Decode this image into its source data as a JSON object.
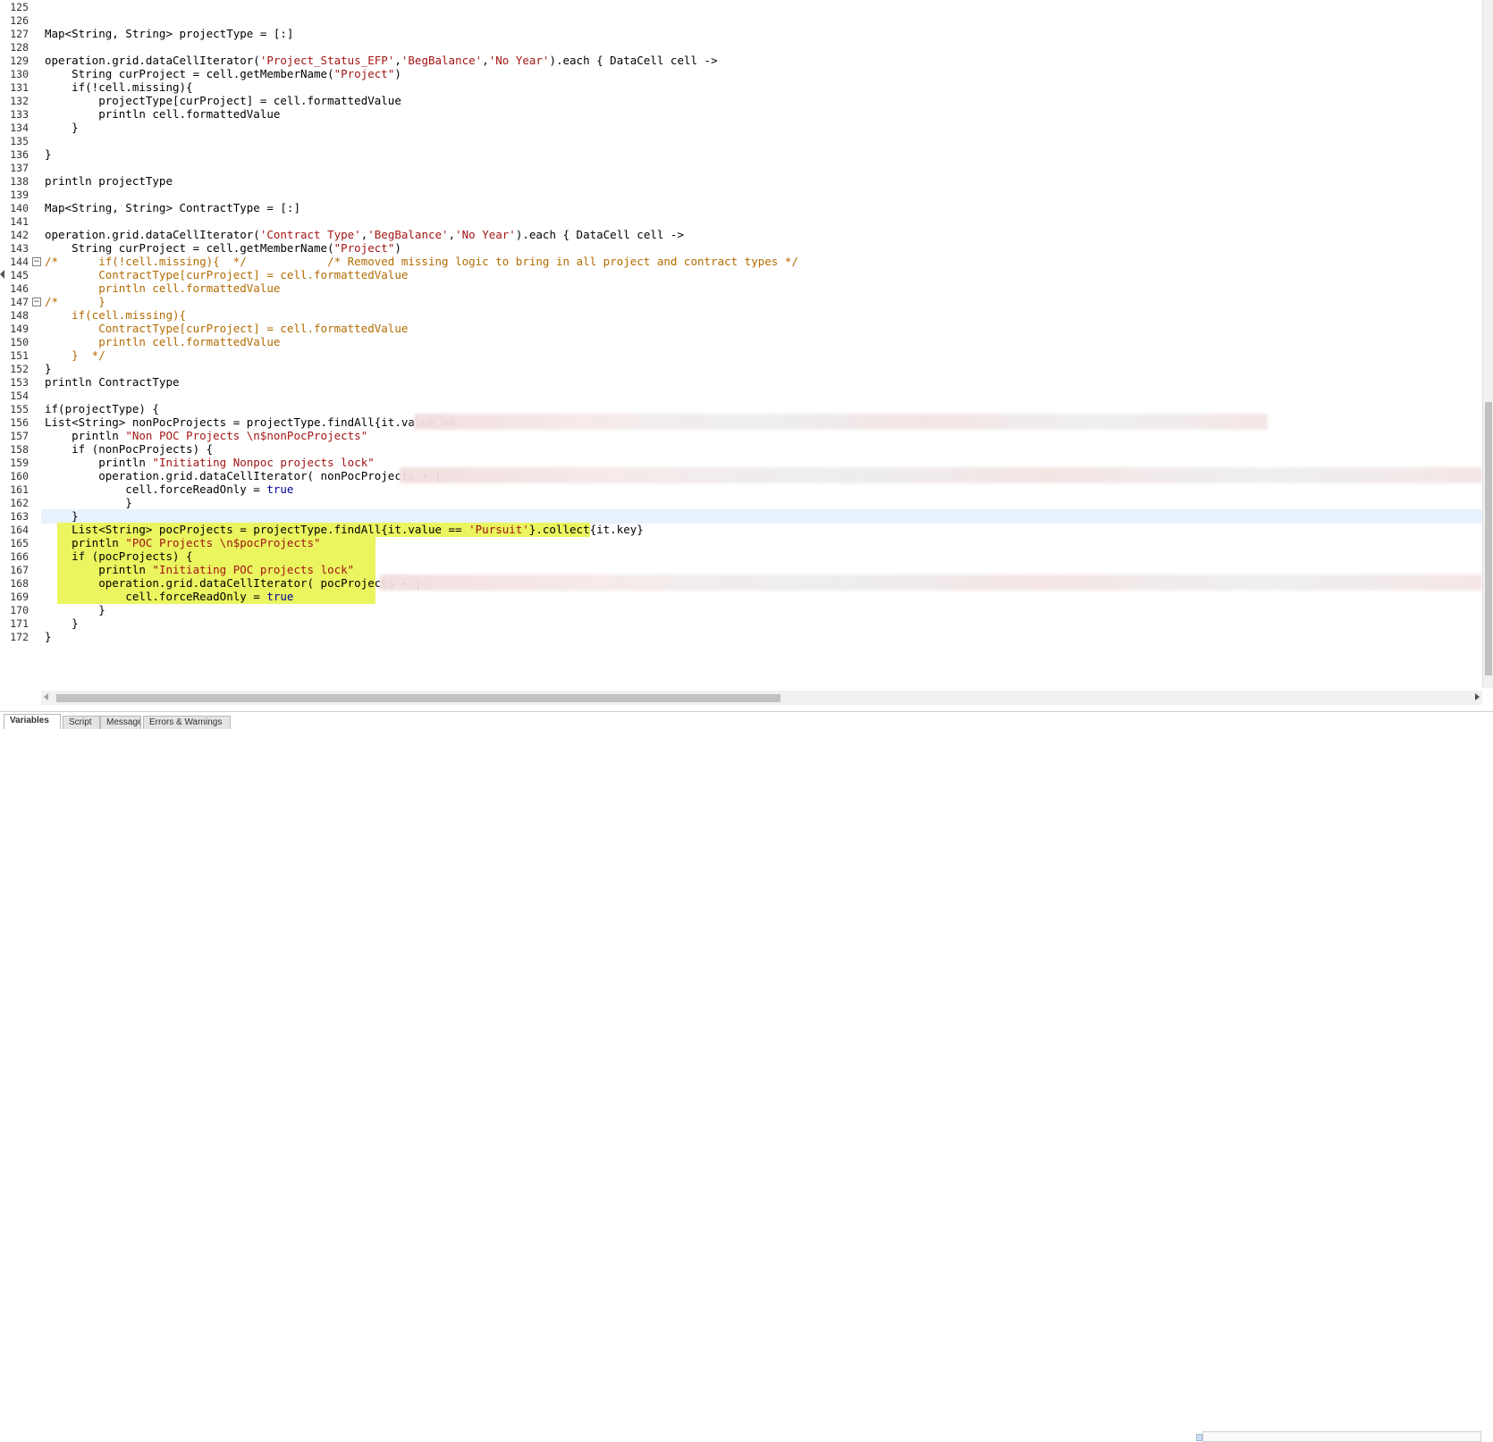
{
  "editor": {
    "lines": [
      {
        "n": "125",
        "text": ""
      },
      {
        "n": "126",
        "text": ""
      },
      {
        "n": "127",
        "text": "Map<String, String> projectType = [:]"
      },
      {
        "n": "128",
        "text": ""
      },
      {
        "n": "129",
        "text": "operation.grid.dataCellIterator('Project_Status_EFP','BegBalance','No Year').each { DataCell cell ->"
      },
      {
        "n": "130",
        "text": "    String curProject = cell.getMemberName(\"Project\")"
      },
      {
        "n": "131",
        "text": "    if(!cell.missing){"
      },
      {
        "n": "132",
        "text": "        projectType[curProject] = cell.formattedValue"
      },
      {
        "n": "133",
        "text": "        println cell.formattedValue"
      },
      {
        "n": "134",
        "text": "    }"
      },
      {
        "n": "135",
        "text": ""
      },
      {
        "n": "136",
        "text": "}"
      },
      {
        "n": "137",
        "text": ""
      },
      {
        "n": "138",
        "text": "println projectType"
      },
      {
        "n": "139",
        "text": ""
      },
      {
        "n": "140",
        "text": "Map<String, String> ContractType = [:]"
      },
      {
        "n": "141",
        "text": ""
      },
      {
        "n": "142",
        "text": "operation.grid.dataCellIterator('Contract Type','BegBalance','No Year').each { DataCell cell ->"
      },
      {
        "n": "143",
        "text": "    String curProject = cell.getMemberName(\"Project\")"
      },
      {
        "n": "144",
        "text": "/*      if(!cell.missing){  */            /* Removed missing logic to bring in all project and contract types */"
      },
      {
        "n": "145",
        "text": "        ContractType[curProject] = cell.formattedValue"
      },
      {
        "n": "146",
        "text": "        println cell.formattedValue"
      },
      {
        "n": "147",
        "text": "/*      }"
      },
      {
        "n": "148",
        "text": "    if(cell.missing){"
      },
      {
        "n": "149",
        "text": "        ContractType[curProject] = cell.formattedValue"
      },
      {
        "n": "150",
        "text": "        println cell.formattedValue"
      },
      {
        "n": "151",
        "text": "    }  */"
      },
      {
        "n": "152",
        "text": "}"
      },
      {
        "n": "153",
        "text": "println ContractType"
      },
      {
        "n": "154",
        "text": ""
      },
      {
        "n": "155",
        "text": "if(projectType) {"
      },
      {
        "n": "156",
        "text": "List<String> nonPocProjects = projectType.findAll{it.value == "
      },
      {
        "n": "157",
        "text": "    println \"Non POC Projects \\n$nonPocProjects\""
      },
      {
        "n": "158",
        "text": "    if (nonPocProjects) {"
      },
      {
        "n": "159",
        "text": "        println \"Initiating Nonpoc projects lock\""
      },
      {
        "n": "160",
        "text": "        operation.grid.dataCellIterator( nonPocProjects + ["
      },
      {
        "n": "161",
        "text": "            cell.forceReadOnly = true"
      },
      {
        "n": "162",
        "text": "            }"
      },
      {
        "n": "163",
        "text": "    }"
      },
      {
        "n": "164",
        "text": "    List<String> pocProjects = projectType.findAll{it.value == 'Pursuit'}.collect{it.key}"
      },
      {
        "n": "165",
        "text": "    println \"POC Projects \\n$pocProjects\""
      },
      {
        "n": "166",
        "text": "    if (pocProjects) {"
      },
      {
        "n": "167",
        "text": "        println \"Initiating POC projects lock\""
      },
      {
        "n": "168",
        "text": "        operation.grid.dataCellIterator( pocProjects + |"
      },
      {
        "n": "169",
        "text": "            cell.forceReadOnly = true"
      },
      {
        "n": "170",
        "text": "        }"
      },
      {
        "n": "171",
        "text": "    }"
      },
      {
        "n": "172",
        "text": "}"
      }
    ]
  },
  "tabs": [
    {
      "label": "Variables",
      "active": true
    },
    {
      "label": "Script",
      "active": false
    },
    {
      "label": "Messages",
      "active": false
    },
    {
      "label": "Errors & Warnings",
      "active": false
    }
  ],
  "colors": {
    "string": "#a31515",
    "keyword": "#00009a",
    "comment": "#b36b00",
    "highlight": "#eaf560",
    "current_line": "#e8f2fe"
  },
  "icons": {
    "fold": "fold-minus-icon",
    "scroll_left": "arrow-left-icon",
    "scroll_right": "arrow-right-icon",
    "gutter_marker": "triangle-left-icon"
  }
}
